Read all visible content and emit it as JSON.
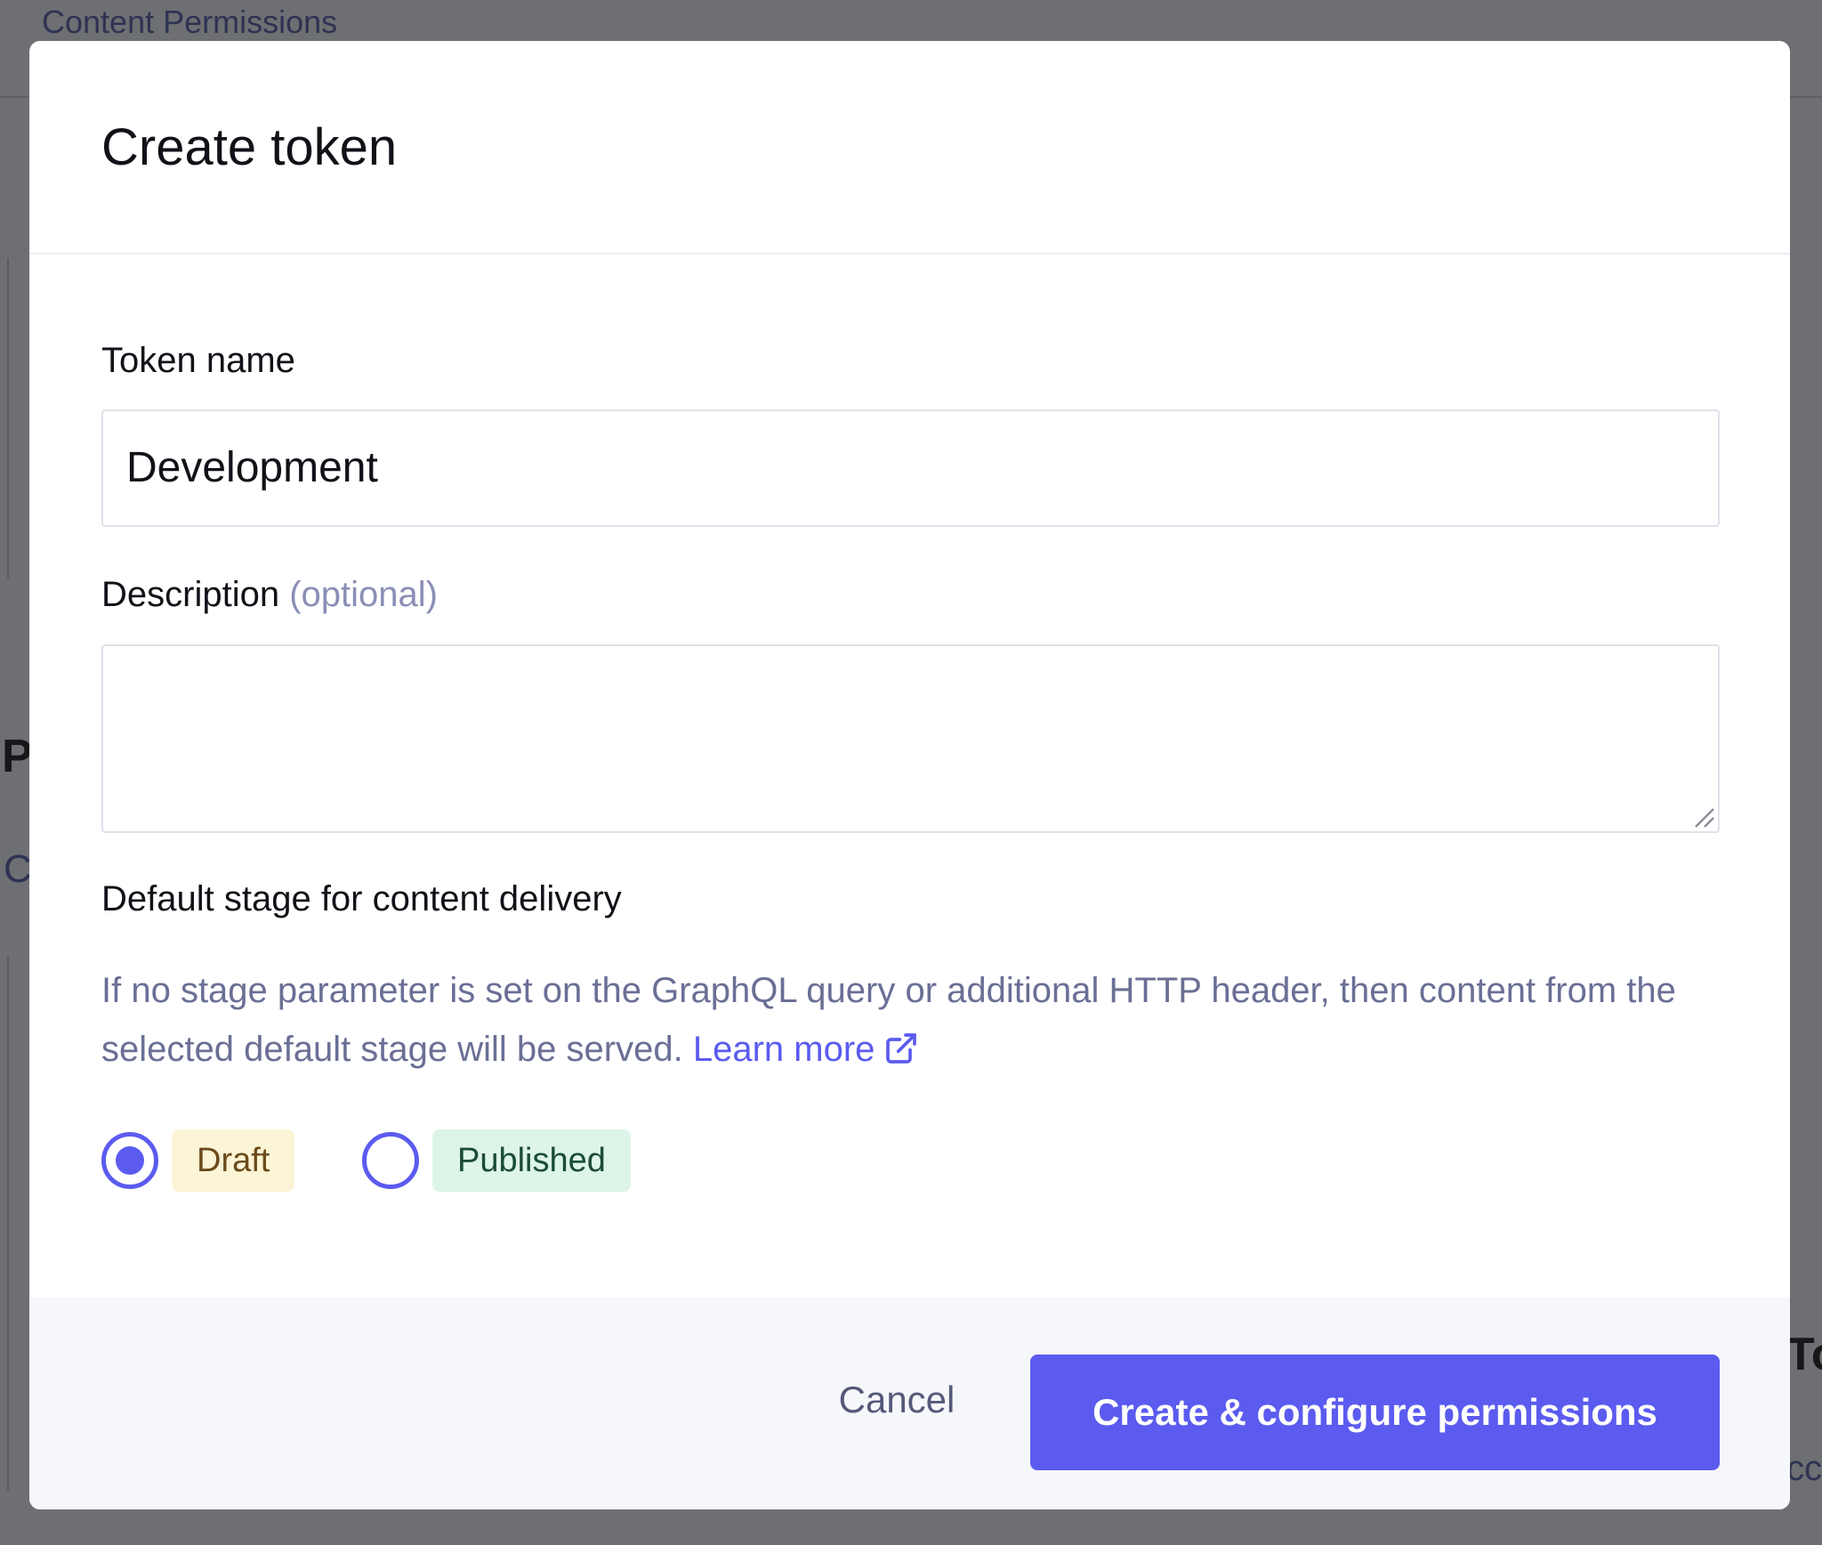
{
  "background": {
    "tab_label": "Content Permissions",
    "fragment_left_heading": "P",
    "fragment_left_text": "C",
    "fragment_right_heading": "To",
    "fragment_right_text": "cc"
  },
  "modal": {
    "title": "Create token",
    "token_name": {
      "label": "Token name",
      "value": "Development"
    },
    "description": {
      "label": "Description",
      "optional_hint": "(optional)",
      "value": ""
    },
    "default_stage": {
      "label": "Default stage for content delivery",
      "help_text": "If no stage parameter is set on the GraphQL query or additional HTTP header, then content from the selected default stage will be served.",
      "learn_more": "Learn more",
      "options": [
        {
          "label": "Draft",
          "selected": true
        },
        {
          "label": "Published",
          "selected": false
        }
      ]
    },
    "footer": {
      "cancel_label": "Cancel",
      "primary_label": "Create & configure permissions"
    }
  },
  "colors": {
    "accent": "#5b5bf0",
    "overlay": "#6e6f73",
    "draft_badge_bg": "#fcf4d6",
    "published_badge_bg": "#ddf4e9",
    "help_text": "#6a6f95"
  },
  "icons": {
    "learn_more": "external-link-icon",
    "textarea_resize": "resize-grip-icon"
  }
}
